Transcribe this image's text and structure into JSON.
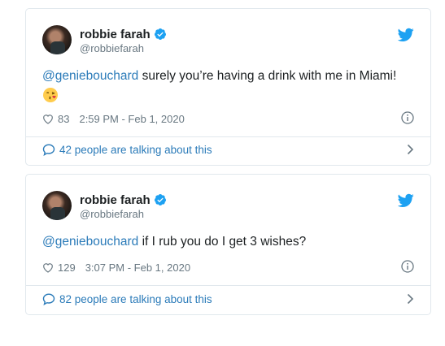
{
  "tweets": [
    {
      "author": {
        "name": "robbie farah",
        "handle": "@robbiefarah"
      },
      "text": {
        "mention": "@geniebouchard",
        "body": " surely you’re having a drink with me in Miami!",
        "emoji": "kissing-face-with-heart"
      },
      "likes": "83",
      "timestamp": "2:59 PM - Feb 1, 2020",
      "talking": "42 people are talking about this"
    },
    {
      "author": {
        "name": "robbie farah",
        "handle": "@robbiefarah"
      },
      "text": {
        "mention": "@geniebouchard",
        "body": " if I rub you do I get 3 wishes?"
      },
      "likes": "129",
      "timestamp": "3:07 PM - Feb 1, 2020",
      "talking": "82 people are talking about this"
    }
  ],
  "colors": {
    "link": "#2b7bb9",
    "verified": "#1da1f2",
    "twitter_bird": "#1da1f2",
    "meta": "#697882",
    "border": "#e1e8ed"
  },
  "icons": [
    "verified-badge-icon",
    "twitter-bird-icon",
    "heart-icon",
    "info-icon",
    "speech-bubble-icon",
    "chevron-right-icon"
  ]
}
